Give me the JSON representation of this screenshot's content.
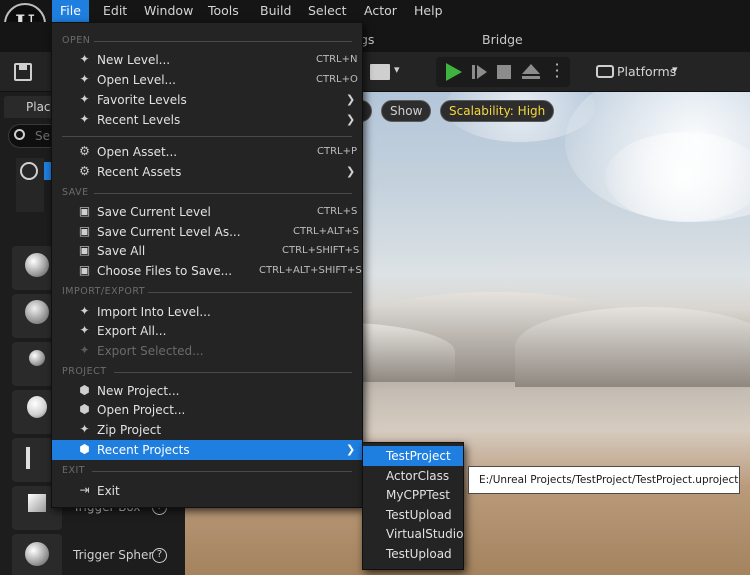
{
  "menubar": {
    "logo": "U",
    "items": [
      "File",
      "Edit",
      "Window",
      "Tools",
      "Build",
      "Select",
      "Actor",
      "Help"
    ]
  },
  "tabs": {
    "settings_fragment": "gs",
    "bridge": "Bridge"
  },
  "toolbar": {
    "platforms_label": "Platforms"
  },
  "place_actors": {
    "title": "Plac",
    "search_placeholder": "Se",
    "actors": [
      "Trigger Box",
      "Trigger Spher"
    ]
  },
  "viewport": {
    "pill_fragment": "t",
    "show_label": "Show",
    "scalability_label": "Scalability: High"
  },
  "file_menu": {
    "sections": {
      "open": "OPEN",
      "save": "SAVE",
      "import_export": "IMPORT/EXPORT",
      "project": "PROJECT",
      "exit": "EXIT"
    },
    "items": {
      "new_level": {
        "label": "New Level...",
        "shortcut": "CTRL+N"
      },
      "open_level": {
        "label": "Open Level...",
        "shortcut": "CTRL+O"
      },
      "favorite_levels": {
        "label": "Favorite Levels"
      },
      "recent_levels": {
        "label": "Recent Levels"
      },
      "open_asset": {
        "label": "Open Asset...",
        "shortcut": "CTRL+P"
      },
      "recent_assets": {
        "label": "Recent Assets"
      },
      "save_current_level": {
        "label": "Save Current Level",
        "shortcut": "CTRL+S"
      },
      "save_current_level_as": {
        "label": "Save Current Level As...",
        "shortcut": "CTRL+ALT+S"
      },
      "save_all": {
        "label": "Save All",
        "shortcut": "CTRL+SHIFT+S"
      },
      "choose_files_to_save": {
        "label": "Choose Files to Save...",
        "shortcut": "CTRL+ALT+SHIFT+S"
      },
      "import_into_level": {
        "label": "Import Into Level..."
      },
      "export_all": {
        "label": "Export All..."
      },
      "export_selected": {
        "label": "Export Selected..."
      },
      "new_project": {
        "label": "New Project..."
      },
      "open_project": {
        "label": "Open Project..."
      },
      "zip_project": {
        "label": "Zip Project"
      },
      "recent_projects": {
        "label": "Recent Projects"
      },
      "exit": {
        "label": "Exit"
      }
    }
  },
  "recent_projects_submenu": {
    "items": [
      "TestProject",
      "ActorClass",
      "MyCPPTest",
      "TestUpload",
      "VirtualStudio",
      "TestUpload"
    ],
    "tooltip": "E:/Unreal Projects/TestProject/TestProject.uproject"
  }
}
